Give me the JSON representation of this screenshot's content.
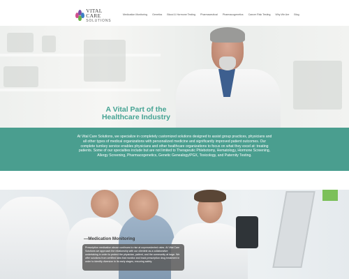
{
  "brand": {
    "name_line1": "VITAL CARE",
    "name_line2": "SOLUTIONS",
    "colors": {
      "teal": "#4a9e8f",
      "title_teal": "#45a393",
      "drop_pink": "#d04e8e",
      "drop_purple": "#7b4fa6",
      "drop_blue": "#3b7fc4",
      "drop_green": "#6bb04a"
    }
  },
  "nav": {
    "items": [
      "Medication Monitoring",
      "Genetics",
      "Blood & Hormone Testing",
      "Pharmaceutical",
      "Pharmacogenetics",
      "Cancer Risk Testing",
      "Why We Are",
      "Blog"
    ]
  },
  "hero": {
    "title": "A Vital Part of the Healthcare Industry"
  },
  "band": {
    "text": "At Vital Care Solutions, we specialize in completely customized solutions designed to assist group practices, physicians and all other types of medical organizations with personalized medicine and significantly improved patient outcomes. Our complete turnkey service enables physicians and other healthcare organizations to focus on what they excel at: treating patients. Some of our specialties include but are not limited to Therapeutic Phlebotomy, Hematology, Hormone Screening, Allergy Screening, Pharmacogenetics, Genetic Genealogy/PGX, Toxicology, and Paternity Testing."
  },
  "medication": {
    "title": "—Medication Monitoring",
    "text": "Prescription medication abuse continues to rise at unprecedented rates. At Vital Care Solutions we approach the relationship with our clientele as a collaborative undertaking in order to protect the physician, patient, and the community at large. We offer solutions from certified labs that monitor and track prescription drug treatment in order to identify diversion in its early stages, ensuring safety."
  }
}
